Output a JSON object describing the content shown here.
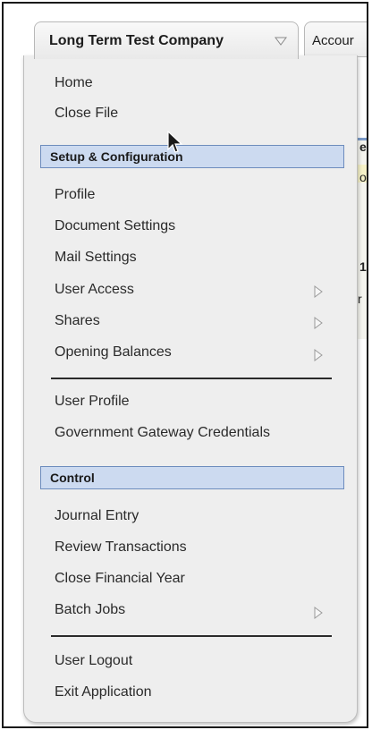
{
  "tabs": {
    "company_name": "Long Term Test Company",
    "next_tab_label": "Accour"
  },
  "background": {
    "fragments": [
      "es",
      "o",
      "1",
      "r"
    ]
  },
  "menu": {
    "home": "Home",
    "close_file": "Close File",
    "setup_header": "Setup & Configuration",
    "profile": "Profile",
    "document_settings": "Document Settings",
    "mail_settings": "Mail Settings",
    "user_access": "User Access",
    "shares": "Shares",
    "opening_balances": "Opening Balances",
    "user_profile": "User Profile",
    "gov_gateway": "Government Gateway Credentials",
    "control_header": "Control",
    "journal_entry": "Journal Entry",
    "review_transactions": "Review Transactions",
    "close_financial_year": "Close Financial Year",
    "batch_jobs": "Batch Jobs",
    "user_logout": "User Logout",
    "exit_application": "Exit Application"
  },
  "colors": {
    "section_fill": "#ccdaf0",
    "section_border": "#6d8cbd",
    "menu_background": "#eeeeee"
  },
  "icons": {
    "dropdown": "triangle-down-outline",
    "submenu": "triangle-right-outline",
    "pointer": "mouse-cursor"
  }
}
